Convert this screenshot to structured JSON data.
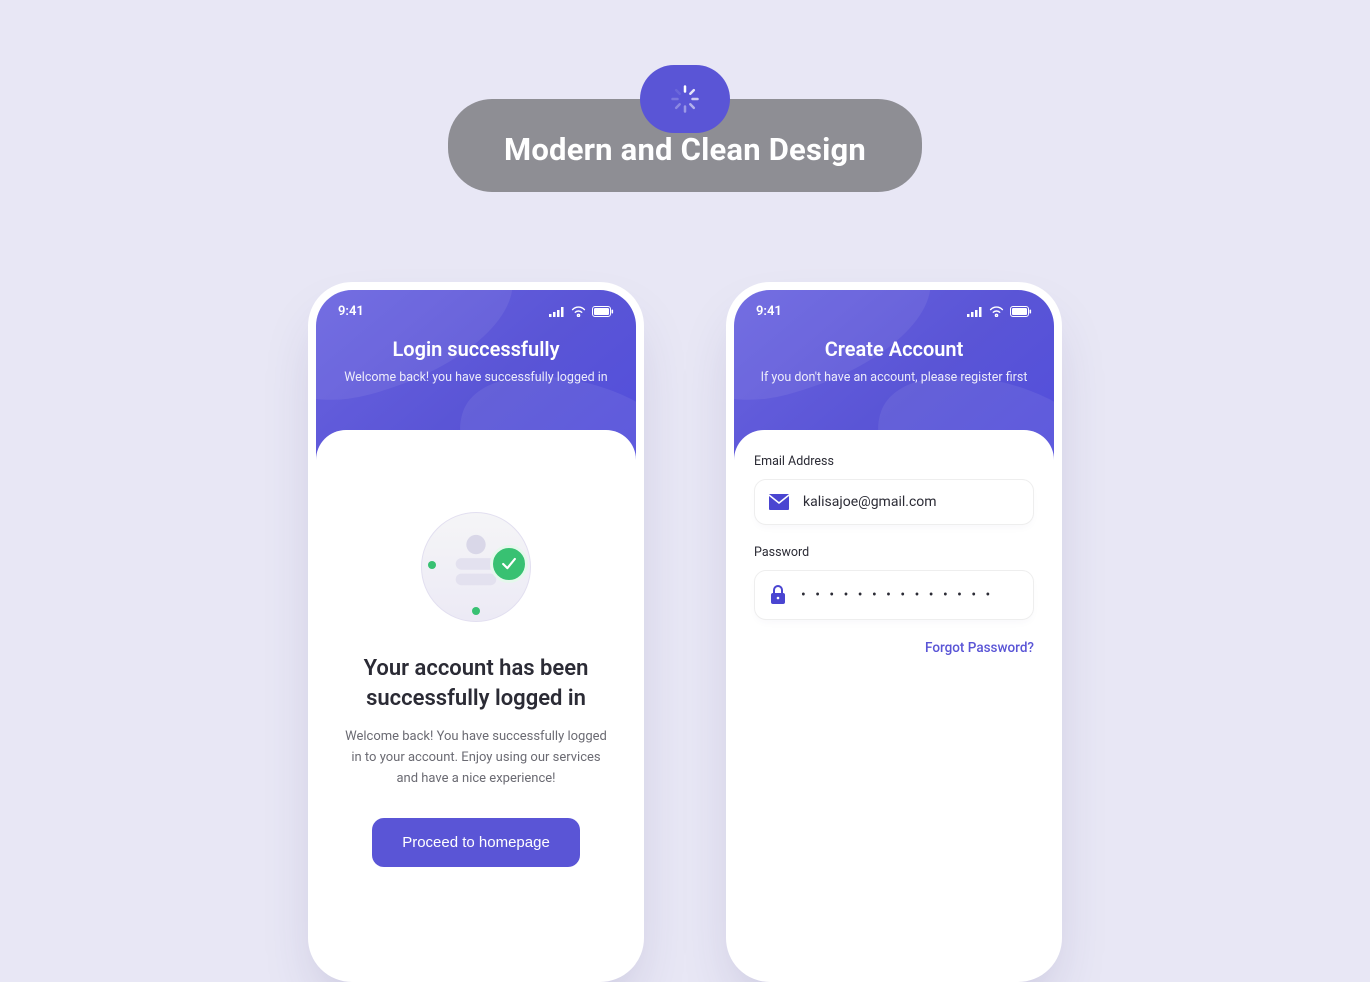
{
  "banner": {
    "title": "Modern and Clean Design"
  },
  "screens": {
    "login_success": {
      "status_time": "9:41",
      "header_title": "Login successfully",
      "header_sub": "Welcome back! you have successfully logged in",
      "body_title": "Your account has been successfully logged in",
      "body_sub": "Welcome back! You have successfully logged in to your account. Enjoy using our services and have a nice experience!",
      "cta": "Proceed to homepage"
    },
    "create_account": {
      "status_time": "9:41",
      "header_title": "Create Account",
      "header_sub": "If you don't have an account, please register first",
      "email_label": "Email Address",
      "email_value": "kalisajoe@gmail.com",
      "password_label": "Password",
      "password_masked": "• • • • • • • • • • • • • •",
      "forgot": "Forgot Password?"
    }
  }
}
